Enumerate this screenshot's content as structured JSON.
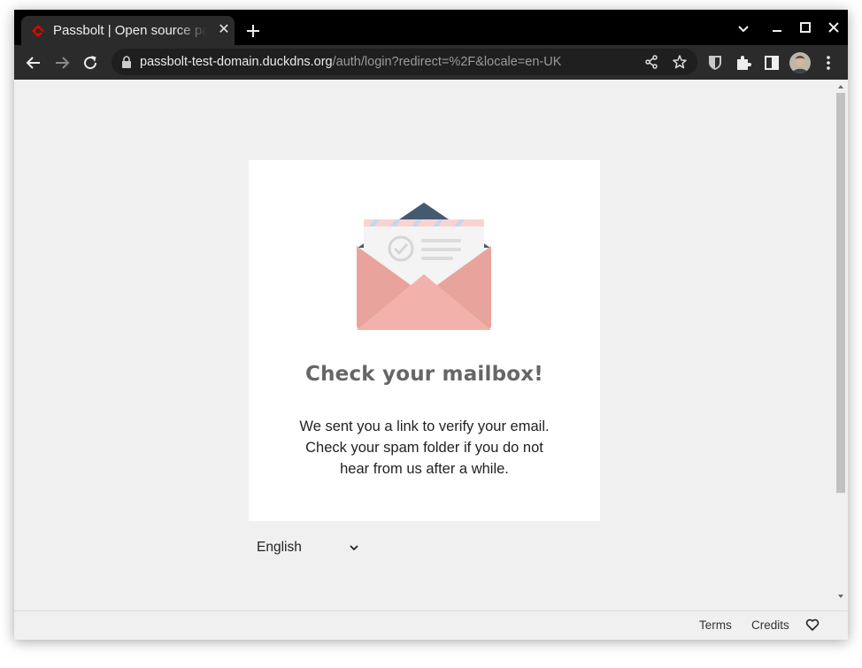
{
  "browser": {
    "tab_title": "Passbolt | Open source password manager",
    "url_host": "passbolt-test-domain.duckdns.org",
    "url_path": "/auth/login?redirect=%2F&locale=en-UK",
    "icons": [
      "passbolt-favicon-icon",
      "close-icon",
      "plus-icon",
      "chevron-down-icon",
      "minimize-icon",
      "maximize-icon",
      "close-window-icon",
      "back-icon",
      "forward-icon",
      "reload-icon",
      "lock-icon",
      "share-icon",
      "star-icon",
      "bitwarden-icon",
      "puzzle-icon",
      "side-panel-icon",
      "kebab-menu-icon"
    ]
  },
  "card": {
    "title": "Check your mailbox!",
    "message": "We sent you a link to verify your email. Check your spam folder if you do not hear from us after a while."
  },
  "language": {
    "selected": "English"
  },
  "footer": {
    "terms": "Terms",
    "credits": "Credits",
    "heart_icon": "heart-icon"
  },
  "colors": {
    "envelope": "#e8a49c",
    "envelope_flap": "#f2b2ab",
    "envelope_top": "#455a6e",
    "title": "#666666",
    "favicon": "#e10600"
  }
}
